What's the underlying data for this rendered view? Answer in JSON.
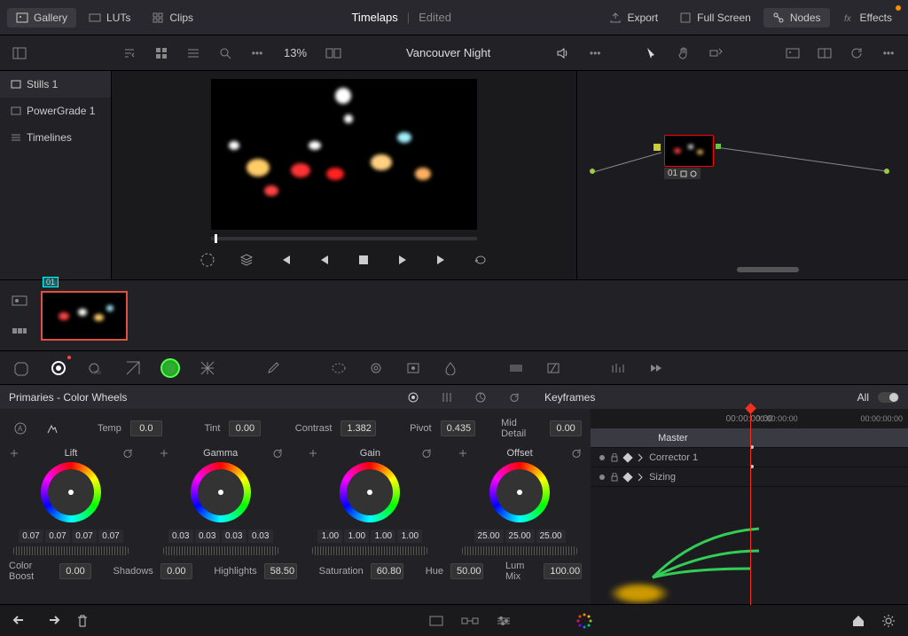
{
  "topbar": {
    "gallery": "Gallery",
    "luts": "LUTs",
    "clips": "Clips",
    "export": "Export",
    "fullscreen": "Full Screen",
    "nodes": "Nodes",
    "effects": "Effects"
  },
  "project": {
    "name": "Timelaps",
    "sub": "Edited"
  },
  "toolbar": {
    "zoom": "13%",
    "clip_name": "Vancouver Night"
  },
  "stills": {
    "items": [
      "Stills 1",
      "PowerGrade 1",
      "Timelines"
    ]
  },
  "node": {
    "label": "01"
  },
  "thumbs": {
    "clip_badge": "01"
  },
  "wheels_panel": {
    "title": "Primaries - Color Wheels",
    "params": {
      "temp_label": "Temp",
      "temp_val": "0.0",
      "tint_label": "Tint",
      "tint_val": "0.00",
      "contrast_label": "Contrast",
      "contrast_val": "1.382",
      "pivot_label": "Pivot",
      "pivot_val": "0.435",
      "mid_label": "Mid Detail",
      "mid_val": "0.00"
    },
    "wheels": [
      {
        "name": "Lift",
        "vals": [
          "0.07",
          "0.07",
          "0.07",
          "0.07"
        ]
      },
      {
        "name": "Gamma",
        "vals": [
          "0.03",
          "0.03",
          "0.03",
          "0.03"
        ]
      },
      {
        "name": "Gain",
        "vals": [
          "1.00",
          "1.00",
          "1.00",
          "1.00"
        ]
      },
      {
        "name": "Offset",
        "vals": [
          "25.00",
          "25.00",
          "25.00"
        ]
      }
    ],
    "bottom": {
      "colboost_l": "Color Boost",
      "colboost_v": "0.00",
      "shadows_l": "Shadows",
      "shadows_v": "0.00",
      "hilite_l": "Highlights",
      "hilite_v": "58.50",
      "sat_l": "Saturation",
      "sat_v": "60.80",
      "hue_l": "Hue",
      "hue_v": "50.00",
      "lum_l": "Lum Mix",
      "lum_v": "100.00"
    }
  },
  "keyframes": {
    "title": "Keyframes",
    "mode": "All",
    "tc_center": "00:00:00:00",
    "tc_left": "00:00:00:00",
    "tc_right": "00:00:00:00",
    "tracks": [
      "Master",
      "Corrector 1",
      "Sizing"
    ]
  }
}
